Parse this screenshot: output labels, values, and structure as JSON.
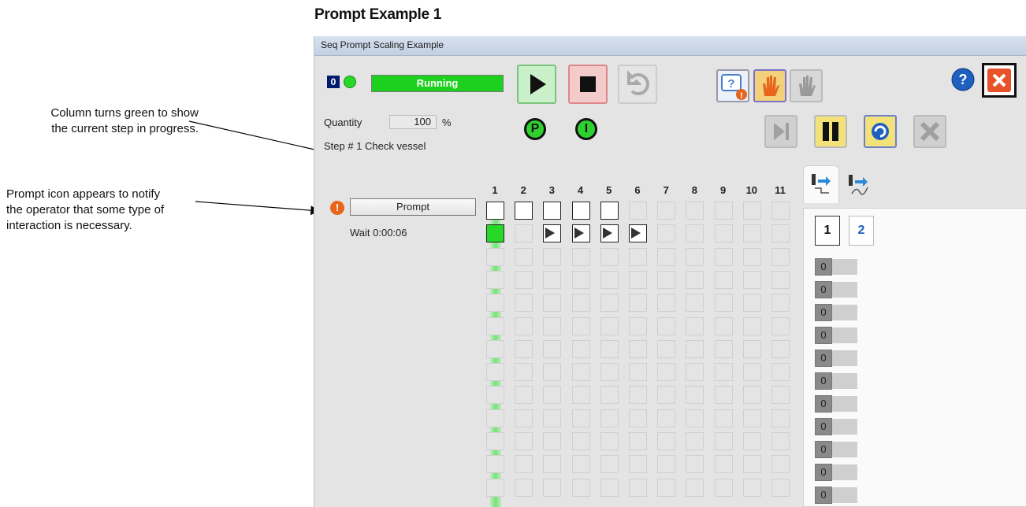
{
  "heading": "Prompt Example 1",
  "annotations": {
    "column_note": "Column turns green to show\nthe current step in progress.",
    "prompt_note": "Prompt icon appears to notify\nthe operator that some type of\ninteraction is necessary."
  },
  "window": {
    "title": "Seq Prompt Scaling Example",
    "pv_indicator": "0",
    "state": "Running",
    "quantity_label": "Quantity",
    "quantity_value": "100",
    "quantity_unit": "%",
    "step_text": "Step # 1  Check vessel",
    "mode_p": "P",
    "mode_i": "I",
    "prompt_button": "Prompt",
    "wait_text": "Wait 0:00:06",
    "columns": [
      "1",
      "2",
      "3",
      "4",
      "5",
      "6",
      "7",
      "8",
      "9",
      "10",
      "11"
    ],
    "page_tabs": [
      "1",
      "2"
    ],
    "registers": [
      "0",
      "0",
      "0",
      "0",
      "0",
      "0",
      "0",
      "0",
      "0",
      "0",
      "0"
    ]
  },
  "colors": {
    "running_green": "#1dd01d",
    "current_column": "#6ee86e",
    "close_red": "#e8522a",
    "help_blue": "#1f5fbf",
    "warning_orange": "#e8661b"
  }
}
